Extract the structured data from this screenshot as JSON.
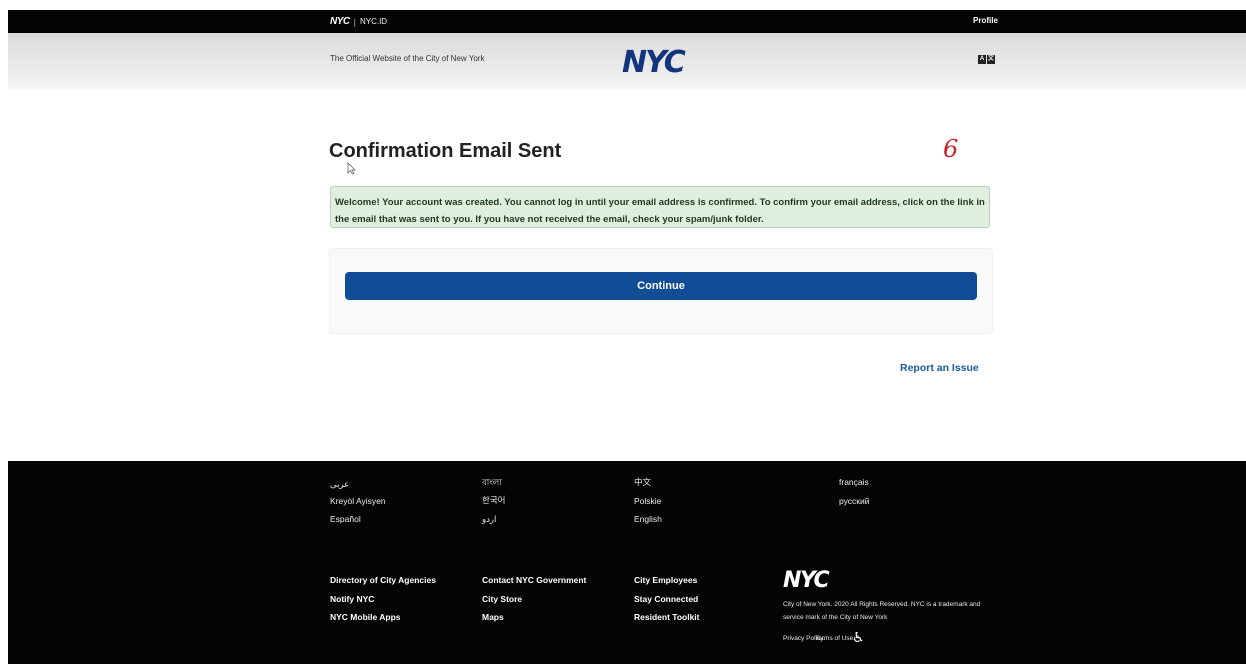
{
  "topbar": {
    "logo": "NYC",
    "section": "NYC.ID",
    "profile": "Profile"
  },
  "header": {
    "official_text": "The Official Website of the City of New York",
    "logo": "NYC",
    "translate_a": "A",
    "translate_b": "文"
  },
  "main": {
    "title": "Confirmation Email Sent",
    "annotation": "6",
    "alert": "Welcome! Your account was created. You cannot log in until your email address is confirmed. To confirm your email address, click on the link in the email that was sent to you. If you have not received the email, check your spam/junk folder.",
    "continue_label": "Continue",
    "report_label": "Report an Issue"
  },
  "footer": {
    "languages": [
      "عربى",
      "বাংলা",
      "中文",
      "français",
      "Kreyòl Ayisyen",
      "한국어",
      "Polskie",
      "русский",
      "Español",
      "اردو",
      "English"
    ],
    "links": [
      "Directory of City Agencies",
      "Contact NYC Government",
      "City Employees",
      "Notify NYC",
      "City Store",
      "Stay Connected",
      "NYC Mobile Apps",
      "Maps",
      "Resident Toolkit"
    ],
    "logo": "NYC",
    "copyright": "City of New York. 2020 All Rights Reserved. NYC is a trademark and service mark of the City of New York",
    "privacy": "Privacy Policy.",
    "terms": "Terms of Use."
  }
}
